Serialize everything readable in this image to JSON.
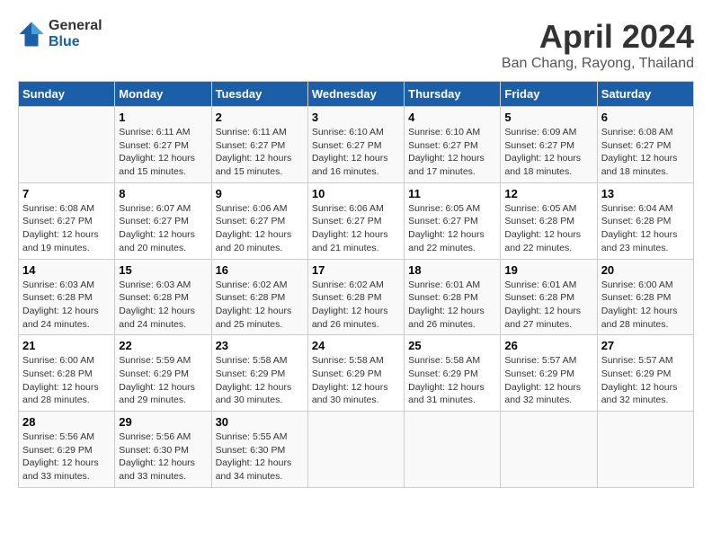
{
  "logo": {
    "general": "General",
    "blue": "Blue"
  },
  "title": "April 2024",
  "subtitle": "Ban Chang, Rayong, Thailand",
  "headers": [
    "Sunday",
    "Monday",
    "Tuesday",
    "Wednesday",
    "Thursday",
    "Friday",
    "Saturday"
  ],
  "weeks": [
    [
      {
        "day": "",
        "info": ""
      },
      {
        "day": "1",
        "info": "Sunrise: 6:11 AM\nSunset: 6:27 PM\nDaylight: 12 hours\nand 15 minutes."
      },
      {
        "day": "2",
        "info": "Sunrise: 6:11 AM\nSunset: 6:27 PM\nDaylight: 12 hours\nand 15 minutes."
      },
      {
        "day": "3",
        "info": "Sunrise: 6:10 AM\nSunset: 6:27 PM\nDaylight: 12 hours\nand 16 minutes."
      },
      {
        "day": "4",
        "info": "Sunrise: 6:10 AM\nSunset: 6:27 PM\nDaylight: 12 hours\nand 17 minutes."
      },
      {
        "day": "5",
        "info": "Sunrise: 6:09 AM\nSunset: 6:27 PM\nDaylight: 12 hours\nand 18 minutes."
      },
      {
        "day": "6",
        "info": "Sunrise: 6:08 AM\nSunset: 6:27 PM\nDaylight: 12 hours\nand 18 minutes."
      }
    ],
    [
      {
        "day": "7",
        "info": "Sunrise: 6:08 AM\nSunset: 6:27 PM\nDaylight: 12 hours\nand 19 minutes."
      },
      {
        "day": "8",
        "info": "Sunrise: 6:07 AM\nSunset: 6:27 PM\nDaylight: 12 hours\nand 20 minutes."
      },
      {
        "day": "9",
        "info": "Sunrise: 6:06 AM\nSunset: 6:27 PM\nDaylight: 12 hours\nand 20 minutes."
      },
      {
        "day": "10",
        "info": "Sunrise: 6:06 AM\nSunset: 6:27 PM\nDaylight: 12 hours\nand 21 minutes."
      },
      {
        "day": "11",
        "info": "Sunrise: 6:05 AM\nSunset: 6:27 PM\nDaylight: 12 hours\nand 22 minutes."
      },
      {
        "day": "12",
        "info": "Sunrise: 6:05 AM\nSunset: 6:28 PM\nDaylight: 12 hours\nand 22 minutes."
      },
      {
        "day": "13",
        "info": "Sunrise: 6:04 AM\nSunset: 6:28 PM\nDaylight: 12 hours\nand 23 minutes."
      }
    ],
    [
      {
        "day": "14",
        "info": "Sunrise: 6:03 AM\nSunset: 6:28 PM\nDaylight: 12 hours\nand 24 minutes."
      },
      {
        "day": "15",
        "info": "Sunrise: 6:03 AM\nSunset: 6:28 PM\nDaylight: 12 hours\nand 24 minutes."
      },
      {
        "day": "16",
        "info": "Sunrise: 6:02 AM\nSunset: 6:28 PM\nDaylight: 12 hours\nand 25 minutes."
      },
      {
        "day": "17",
        "info": "Sunrise: 6:02 AM\nSunset: 6:28 PM\nDaylight: 12 hours\nand 26 minutes."
      },
      {
        "day": "18",
        "info": "Sunrise: 6:01 AM\nSunset: 6:28 PM\nDaylight: 12 hours\nand 26 minutes."
      },
      {
        "day": "19",
        "info": "Sunrise: 6:01 AM\nSunset: 6:28 PM\nDaylight: 12 hours\nand 27 minutes."
      },
      {
        "day": "20",
        "info": "Sunrise: 6:00 AM\nSunset: 6:28 PM\nDaylight: 12 hours\nand 28 minutes."
      }
    ],
    [
      {
        "day": "21",
        "info": "Sunrise: 6:00 AM\nSunset: 6:28 PM\nDaylight: 12 hours\nand 28 minutes."
      },
      {
        "day": "22",
        "info": "Sunrise: 5:59 AM\nSunset: 6:29 PM\nDaylight: 12 hours\nand 29 minutes."
      },
      {
        "day": "23",
        "info": "Sunrise: 5:58 AM\nSunset: 6:29 PM\nDaylight: 12 hours\nand 30 minutes."
      },
      {
        "day": "24",
        "info": "Sunrise: 5:58 AM\nSunset: 6:29 PM\nDaylight: 12 hours\nand 30 minutes."
      },
      {
        "day": "25",
        "info": "Sunrise: 5:58 AM\nSunset: 6:29 PM\nDaylight: 12 hours\nand 31 minutes."
      },
      {
        "day": "26",
        "info": "Sunrise: 5:57 AM\nSunset: 6:29 PM\nDaylight: 12 hours\nand 32 minutes."
      },
      {
        "day": "27",
        "info": "Sunrise: 5:57 AM\nSunset: 6:29 PM\nDaylight: 12 hours\nand 32 minutes."
      }
    ],
    [
      {
        "day": "28",
        "info": "Sunrise: 5:56 AM\nSunset: 6:29 PM\nDaylight: 12 hours\nand 33 minutes."
      },
      {
        "day": "29",
        "info": "Sunrise: 5:56 AM\nSunset: 6:30 PM\nDaylight: 12 hours\nand 33 minutes."
      },
      {
        "day": "30",
        "info": "Sunrise: 5:55 AM\nSunset: 6:30 PM\nDaylight: 12 hours\nand 34 minutes."
      },
      {
        "day": "",
        "info": ""
      },
      {
        "day": "",
        "info": ""
      },
      {
        "day": "",
        "info": ""
      },
      {
        "day": "",
        "info": ""
      }
    ]
  ]
}
